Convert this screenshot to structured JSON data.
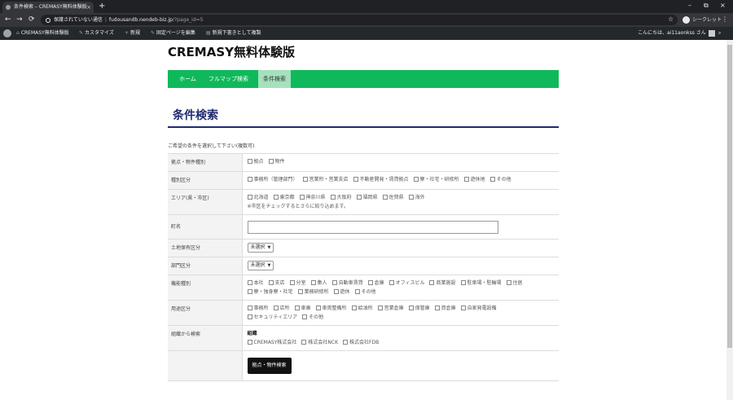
{
  "browser": {
    "tab_title": "条件検索 – CREMASY無料体験版",
    "tab_close": "×",
    "new_tab": "+",
    "win_minimize": "–",
    "win_maximize": "⧉",
    "win_close": "×",
    "back": "←",
    "forward": "→",
    "reload": "⟳",
    "security_text": "保護されていない通信",
    "url_host": "fudousandb.nendeb-biz.jp",
    "url_path": "/?page_id=5",
    "star": "☆",
    "profile_label": "シークレット",
    "menu": "⋮"
  },
  "adminbar": {
    "site_name": "CREMASY無料体験版",
    "customize": "カスタマイズ",
    "new": "新規",
    "edit_page": "固定ページを編集",
    "save_draft": "新規下書きとして複製",
    "greeting": "こんにちは、ai11aonkss さん",
    "search": "⌕",
    "icon_customize": "✎",
    "icon_new": "+",
    "icon_edit": "✎",
    "icon_draft": "▤"
  },
  "site": {
    "title": "CREMASY無料体験版",
    "nav": [
      "ホーム",
      "フルマップ検索",
      "条件検索"
    ]
  },
  "page": {
    "heading": "条件検索",
    "intro": "ご希望の条件を選択して下さい(複数可)"
  },
  "form": {
    "row_kyoten": {
      "label": "拠点・物件種別",
      "options": [
        "拠点",
        "物件"
      ]
    },
    "row_shubetsu": {
      "label": "種別区分",
      "options": [
        "事務所（管理部門）",
        "営業所・営業支店",
        "不動産開発・賃貸拠点",
        "寮・社宅・研修所",
        "遊休地",
        "その他"
      ]
    },
    "row_area": {
      "label": "エリア(県・市区)",
      "options": [
        "北海道",
        "東京都",
        "神奈川県",
        "大阪府",
        "福岡県",
        "佐賀県",
        "海外"
      ],
      "note": "※市区をチェックするとさらに絞り込めます。"
    },
    "row_town": {
      "label": "町名",
      "value": ""
    },
    "row_land": {
      "label": "土地保有区分",
      "selected": "未選択"
    },
    "row_dept": {
      "label": "部門区分",
      "selected": "未選択"
    },
    "row_function": {
      "label": "機能種別",
      "options": [
        "本社",
        "支店",
        "分室",
        "集人",
        "自動車賃貸",
        "倉庫",
        "オフィスビル",
        "商業施設",
        "駐車場・駐輪場",
        "住居",
        "寮・独身寮・社宅",
        "業務研修所",
        "遊休",
        "その他"
      ]
    },
    "row_usage": {
      "label": "用途区分",
      "options": [
        "事務所",
        "店所",
        "車庫",
        "車両整備所",
        "給油所",
        "営業倉庫",
        "保管庫",
        "資倉庫",
        "自家発電設備",
        "セキュリティエリア",
        "その他"
      ]
    },
    "row_org": {
      "label": "組織から検索",
      "group_title": "組織",
      "options": [
        "CREMASY株式会社",
        "株式会社NCK",
        "株式会社FDB"
      ]
    },
    "submit_label": "拠点・物件検索"
  },
  "colors": {
    "nav_green": "#0fb95b",
    "heading_navy": "#1f2a6e",
    "adminbar": "#23282d"
  }
}
